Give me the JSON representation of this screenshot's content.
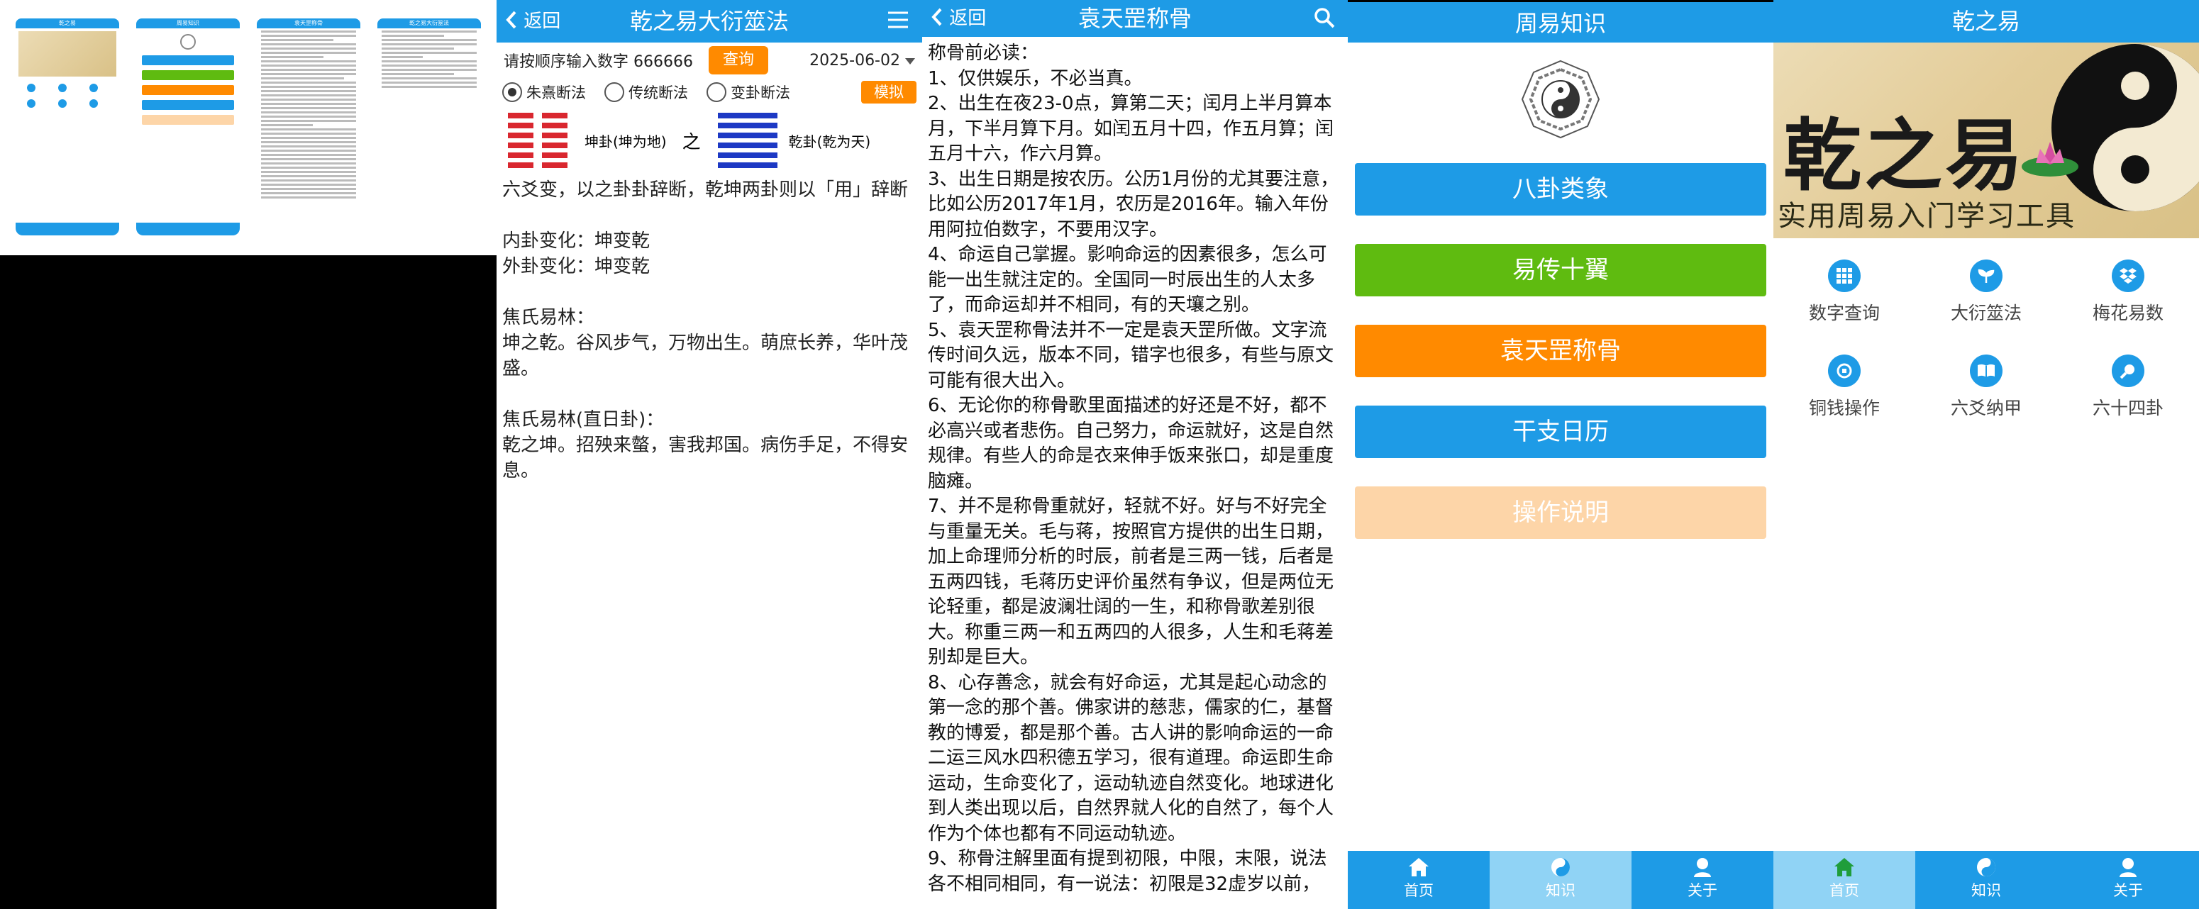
{
  "thumbs": {
    "t1_title": "乾之易",
    "t2_title": "周易知识",
    "t3_title": "袁天罡称骨",
    "t4_title": "乾之易大衍筮法"
  },
  "dayan": {
    "back": "返回",
    "title": "乾之易大衍筮法",
    "prompt": "请按顺序输入数字 666666",
    "query_btn": "查询",
    "date": "2025-06-02",
    "radios": [
      "朱熹断法",
      "传统断法",
      "变卦断法"
    ],
    "simulate_btn": "模拟",
    "gua_from": "坤卦(坤为地)",
    "gua_of": "之",
    "gua_to": "乾卦(乾为天)",
    "lines": [
      "六爻变，以之卦卦辞断，乾坤两卦则以「用」辞断",
      "",
      "内卦变化：坤变乾",
      "外卦变化：坤变乾",
      "",
      "焦氏易林：",
      "坤之乾。谷风步气，万物出生。萌庶长养，华叶茂盛。",
      "",
      "焦氏易林(直日卦)：",
      "乾之坤。招殃来螫，害我邦国。病伤手足，不得安息。"
    ]
  },
  "yuan": {
    "back": "返回",
    "title": "袁天罡称骨",
    "lines": [
      "称骨前必读：",
      "1、仅供娱乐，不必当真。",
      "2、出生在夜23-0点，算第二天；闰月上半月算本月，下半月算下月。如闰五月十四，作五月算；闰五月十六，作六月算。",
      "3、出生日期是按农历。公历1月份的尤其要注意，比如公历2017年1月，农历是2016年。输入年份用阿拉伯数字，不要用汉字。",
      "4、命运自己掌握。影响命运的因素很多，怎么可能一出生就注定的。全国同一时辰出生的人太多了，而命运却并不相同，有的天壤之别。",
      "5、袁天罡称骨法并不一定是袁天罡所做。文字流传时间久远，版本不同，错字也很多，有些与原文可能有很大出入。",
      "6、无论你的称骨歌里面描述的好还是不好，都不必高兴或者悲伤。自己努力，命运就好，这是自然规律。有些人的命是衣来伸手饭来张口，却是重度脑瘫。",
      "7、并不是称骨重就好，轻就不好。好与不好完全与重量无关。毛与蒋，按照官方提供的出生日期，加上命理师分析的时辰，前者是三两一钱，后者是五两四钱，毛蒋历史评价虽然有争议，但是两位无论轻重，都是波澜壮阔的一生，和称骨歌差别很大。称重三两一和五两四的人很多，人生和毛蒋差别却是巨大。",
      "8、心存善念，就会有好命运，尤其是起心动念的第一念的那个善。佛家讲的慈悲，儒家的仁，基督教的博爱，都是那个善。古人讲的影响命运的一命二运三风水四积德五学习，很有道理。命运即生命运动，生命变化了，运动轨迹自然变化。地球进化到人类出现以后，自然界就人化的自然了，每个人作为个体也都有不同运动轨迹。",
      "9、称骨注解里面有提到初限，中限，末限，说法各不相同相同，有一说法：初限是32虚岁以前，"
    ]
  },
  "zhishi": {
    "title": "周易知识",
    "buttons": [
      "八卦类象",
      "易传十翼",
      "袁天罡称骨",
      "干支日历",
      "操作说明"
    ],
    "button_colors": [
      "#1e9be6",
      "#5fbb10",
      "#ff8a00",
      "#1e9be6",
      "#fdd5a8"
    ],
    "nav": [
      "首页",
      "知识",
      "关于"
    ]
  },
  "home": {
    "title": "乾之易",
    "banner_title": "乾之易",
    "banner_sub": "实用周易入门学习工具",
    "grid": [
      "数字查询",
      "大衍筮法",
      "梅花易数",
      "铜钱操作",
      "六爻纳甲",
      "六十四卦"
    ],
    "grid_icons": [
      "grid-icon",
      "sprout-icon",
      "dropbox-icon",
      "coin-icon",
      "book-icon",
      "search-icon"
    ],
    "nav": [
      "首页",
      "知识",
      "关于"
    ]
  },
  "colors": {
    "primary": "#1e9be6",
    "orange": "#ff8a00",
    "green": "#5fbb10",
    "peach": "#fdd5a8",
    "nav_selected": "#90d3f5",
    "hex_red": "#d9272f",
    "hex_blue": "#1d39c4"
  }
}
